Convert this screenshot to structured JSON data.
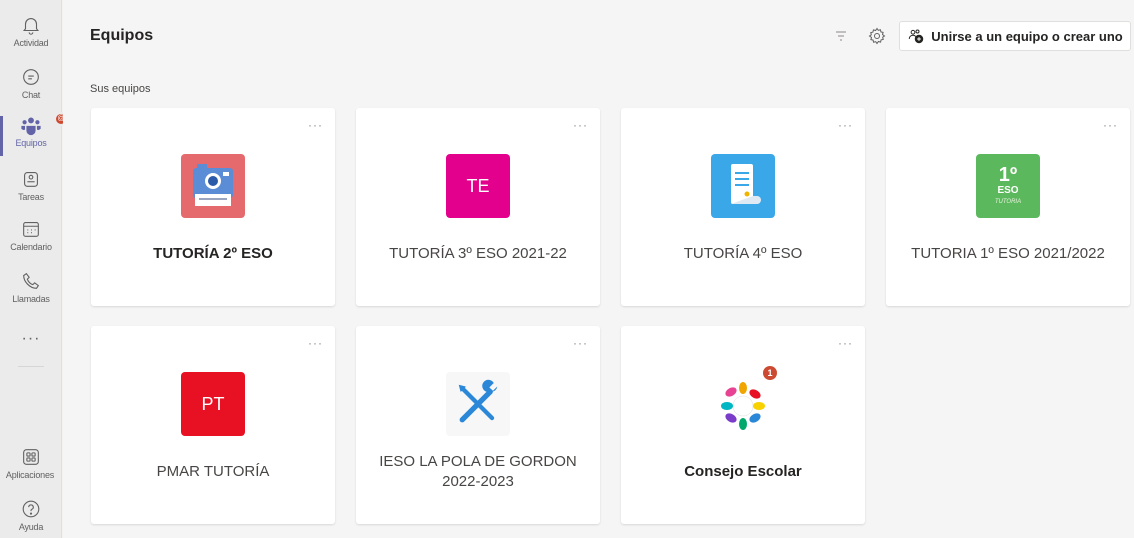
{
  "rail": {
    "items": [
      {
        "label": "Actividad",
        "icon": "bell-icon"
      },
      {
        "label": "Chat",
        "icon": "chat-icon"
      },
      {
        "label": "Equipos",
        "icon": "teams-icon",
        "badge": "@"
      },
      {
        "label": "Tareas",
        "icon": "assignments-icon"
      },
      {
        "label": "Calendario",
        "icon": "calendar-icon"
      },
      {
        "label": "Llamadas",
        "icon": "phone-icon"
      },
      {
        "label": "···",
        "icon": "more-icon"
      },
      {
        "label": "Aplicaciones",
        "icon": "apps-icon"
      },
      {
        "label": "Ayuda",
        "icon": "help-icon"
      }
    ],
    "active_color": "#6264a7"
  },
  "header": {
    "title": "Equipos",
    "filter_icon": "filter-icon",
    "settings_icon": "gear-icon",
    "join_label": "Unirse a un equipo o crear uno"
  },
  "section_label": "Sus equipos",
  "teams": [
    {
      "name": "TUTORÍA 2º ESO",
      "avatar": "camera",
      "avatar_color": "#e46a6e",
      "bold": true,
      "more": "···"
    },
    {
      "name": "TUTORÍA 3º ESO 2021-22",
      "avatar": "initials",
      "initials": "TE",
      "avatar_color": "#e3008c",
      "bold": false,
      "more": "···"
    },
    {
      "name": "TUTORÍA 4º ESO",
      "avatar": "scroll",
      "avatar_color": "#3aa8e8",
      "bold": false,
      "more": "···"
    },
    {
      "name": "TUTORIA 1º ESO 2021/2022",
      "avatar": "eso",
      "avatar_color": "#5cb85c",
      "avatar_text_big": "1º",
      "avatar_text_mid": "ESO",
      "avatar_text_small": "TUTORIA",
      "bold": false,
      "more": "···"
    },
    {
      "name": "PMAR TUTORÍA",
      "avatar": "initials",
      "initials": "PT",
      "avatar_color": "#e81123",
      "bold": false,
      "more": "···"
    },
    {
      "name": "IESO LA POLA DE GORDON 2022-2023",
      "avatar": "tools",
      "avatar_color": "#2b88d8",
      "bold": false,
      "more": "···"
    },
    {
      "name": "Consejo Escolar",
      "avatar": "hands",
      "avatar_color": "#ffffff",
      "bold": true,
      "more": "···",
      "badge": "1"
    }
  ]
}
